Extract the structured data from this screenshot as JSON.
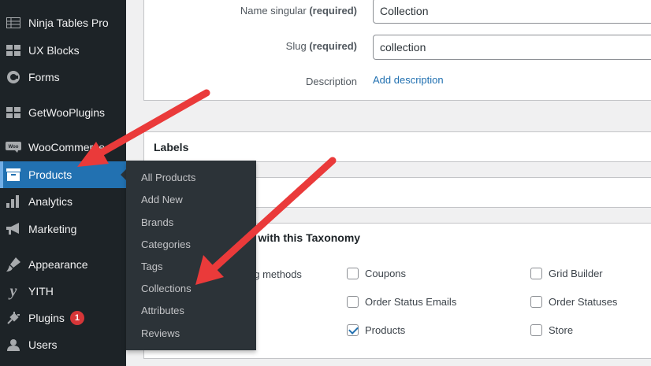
{
  "sidebar": {
    "items": [
      {
        "label": "Ninja Tables Pro",
        "icon": "table-icon",
        "active": false
      },
      {
        "label": "UX Blocks",
        "icon": "blocks-icon",
        "active": false
      },
      {
        "label": "Forms",
        "icon": "forms-icon",
        "active": false
      },
      {
        "label": "GetWooPlugins",
        "icon": "grid-icon",
        "active": false
      },
      {
        "label": "WooCommerce",
        "icon": "woo-icon",
        "active": false
      },
      {
        "label": "Products",
        "icon": "archive-icon",
        "active": true
      },
      {
        "label": "Analytics",
        "icon": "bar-chart-icon",
        "active": false
      },
      {
        "label": "Marketing",
        "icon": "megaphone-icon",
        "active": false
      },
      {
        "label": "Appearance",
        "icon": "paintbrush-icon",
        "active": false
      },
      {
        "label": "YITH",
        "icon": "yith-icon",
        "active": false
      },
      {
        "label": "Plugins",
        "icon": "plug-icon",
        "active": false,
        "badge": "1"
      },
      {
        "label": "Users",
        "icon": "user-icon",
        "active": false
      }
    ]
  },
  "submenu": {
    "items": [
      "All Products",
      "Add New",
      "Brands",
      "Categories",
      "Tags",
      "Collections",
      "Attributes",
      "Reviews"
    ]
  },
  "form": {
    "name_singular": {
      "label": "Name singular",
      "required": "(required)",
      "value": "Collection"
    },
    "slug": {
      "label": "Slug",
      "required": "(required)",
      "value": "collection"
    },
    "description": {
      "label": "Description",
      "link": "Add description"
    }
  },
  "labels_section": {
    "title": "Labels"
  },
  "taxonomy_section": {
    "title": "d with this Taxonomy",
    "partial_label": "ng methods",
    "checkboxes": [
      {
        "label": "Coupons",
        "checked": false
      },
      {
        "label": "Order Status Emails",
        "checked": false
      },
      {
        "label": "Products",
        "checked": true
      },
      {
        "label": "Grid Builder",
        "checked": false
      },
      {
        "label": "Order Statuses",
        "checked": false
      },
      {
        "label": "Store",
        "checked": false
      }
    ]
  },
  "colors": {
    "accent": "#2271b1",
    "arrow": "#ea3a3a",
    "sidebar": "#1d2327",
    "submenu": "#2c3338"
  }
}
